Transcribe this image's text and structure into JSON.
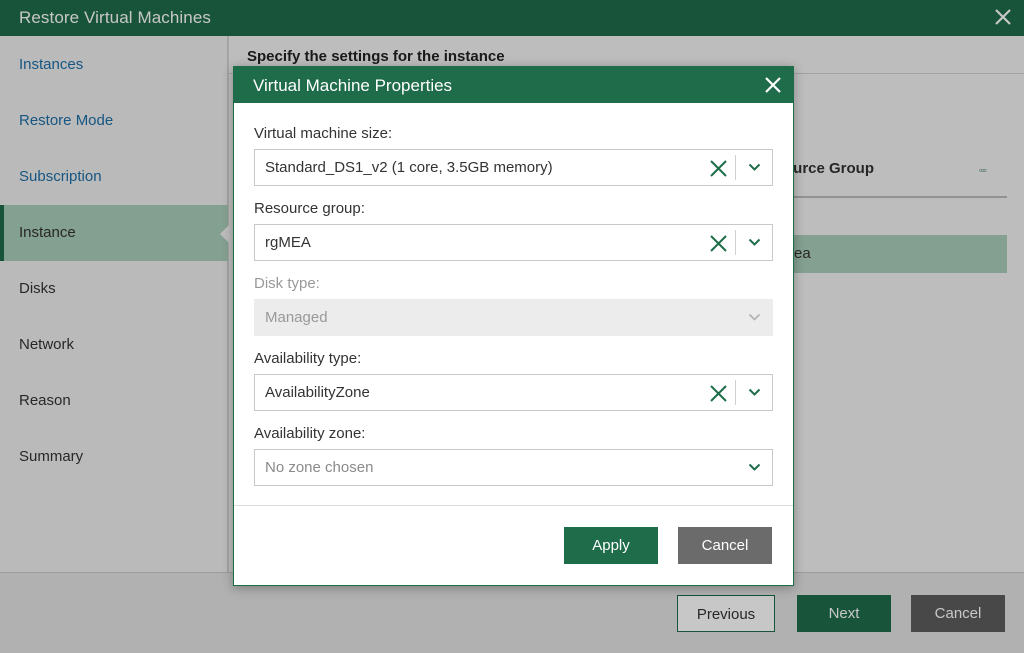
{
  "window": {
    "title": "Restore Virtual Machines"
  },
  "sidebar": {
    "items": [
      {
        "label": "Instances"
      },
      {
        "label": "Restore Mode"
      },
      {
        "label": "Subscription"
      },
      {
        "label": "Instance"
      },
      {
        "label": "Disks"
      },
      {
        "label": "Network"
      },
      {
        "label": "Reason"
      },
      {
        "label": "Summary"
      }
    ],
    "active": "Instance"
  },
  "content": {
    "heading": "Specify the settings for the instance",
    "column_header": "ource Group",
    "selected_row_text": "ea",
    "column_icon": "▫▫▫"
  },
  "footer": {
    "previous_label": "Previous",
    "next_label": "Next",
    "cancel_label": "Cancel"
  },
  "modal": {
    "title": "Virtual Machine Properties",
    "fields": [
      {
        "label": "Virtual machine size:",
        "value": "Standard_DS1_v2 (1 core, 3.5GB memory)",
        "enabled": true,
        "clearable": true
      },
      {
        "label": "Resource group:",
        "value": "rgMEA",
        "enabled": true,
        "clearable": true
      },
      {
        "label": "Disk type:",
        "value": "Managed",
        "enabled": false,
        "clearable": false
      },
      {
        "label": "Availability type:",
        "value": "AvailabilityZone",
        "enabled": true,
        "clearable": true
      },
      {
        "label": "Availability zone:",
        "placeholder": "No zone chosen",
        "enabled": true,
        "clearable": false
      }
    ],
    "apply_label": "Apply",
    "cancel_label": "Cancel"
  },
  "colors": {
    "accent": "#1e6c4a",
    "selection": "#a9cdb9",
    "link": "#1d6fa8"
  }
}
